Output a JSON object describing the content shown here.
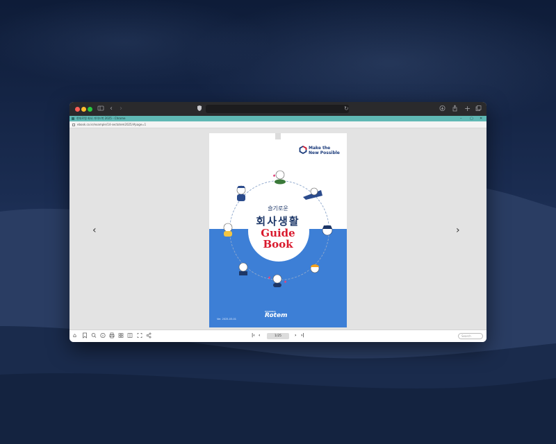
{
  "browser": {
    "title": "현대로템 회사 가이드북 2025 - Chrome",
    "url": "ebook.co.kr/example/14-sectotem2025/#page=1",
    "window_controls": [
      "–",
      "▢",
      "✕"
    ]
  },
  "cover": {
    "brand_line1": "Make the",
    "brand_line2": "New Possible",
    "subtitle": "슬기로운",
    "title": "회사생활",
    "guide": "Guide",
    "book": "Book",
    "version": "Ver. 2025-03-01",
    "company_small": "HYUNDAI",
    "company": "Rotem"
  },
  "pager": {
    "page_count": "1/25"
  },
  "search": {
    "placeholder": "Search"
  },
  "colors": {
    "cover_blue": "#3d7fd6",
    "title_navy": "#1d3768",
    "title_red": "#d9192d",
    "chrome_bar": "#5fb8b4"
  },
  "icons": [
    "sidebar-icon",
    "back-icon",
    "forward-icon",
    "shield-icon",
    "reload-icon",
    "download-icon",
    "share-icon",
    "new-tab-icon",
    "tabs-icon",
    "home-icon",
    "bookmark-icon",
    "search-icon",
    "info-icon",
    "print-icon",
    "thumbnails-icon",
    "single-page-icon",
    "fullscreen-icon",
    "share-network-icon"
  ]
}
